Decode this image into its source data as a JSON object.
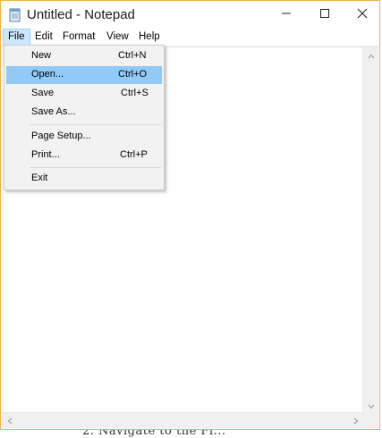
{
  "window": {
    "title": "Untitled - Notepad",
    "accent_border": "#f0b050"
  },
  "title_controls": {
    "minimize_icon": "minimize-icon",
    "maximize_icon": "maximize-icon",
    "close_icon": "close-icon"
  },
  "menubar": {
    "items": [
      {
        "label": "File",
        "active": true
      },
      {
        "label": "Edit"
      },
      {
        "label": "Format"
      },
      {
        "label": "View"
      },
      {
        "label": "Help"
      }
    ]
  },
  "file_menu": {
    "items": [
      {
        "label": "New",
        "shortcut": "Ctrl+N"
      },
      {
        "label": "Open...",
        "shortcut": "Ctrl+O",
        "highlighted": true
      },
      {
        "label": "Save",
        "shortcut": "Ctrl+S"
      },
      {
        "label": "Save As...",
        "shortcut": ""
      },
      {
        "label": "Page Setup...",
        "shortcut": ""
      },
      {
        "label": "Print...",
        "shortcut": "Ctrl+P"
      },
      {
        "label": "Exit",
        "shortcut": ""
      }
    ],
    "highlight_color": "#91c9f7"
  },
  "editor": {
    "content": ""
  },
  "background_fragment": {
    "text": "2.   Navigate to the Fi..."
  }
}
